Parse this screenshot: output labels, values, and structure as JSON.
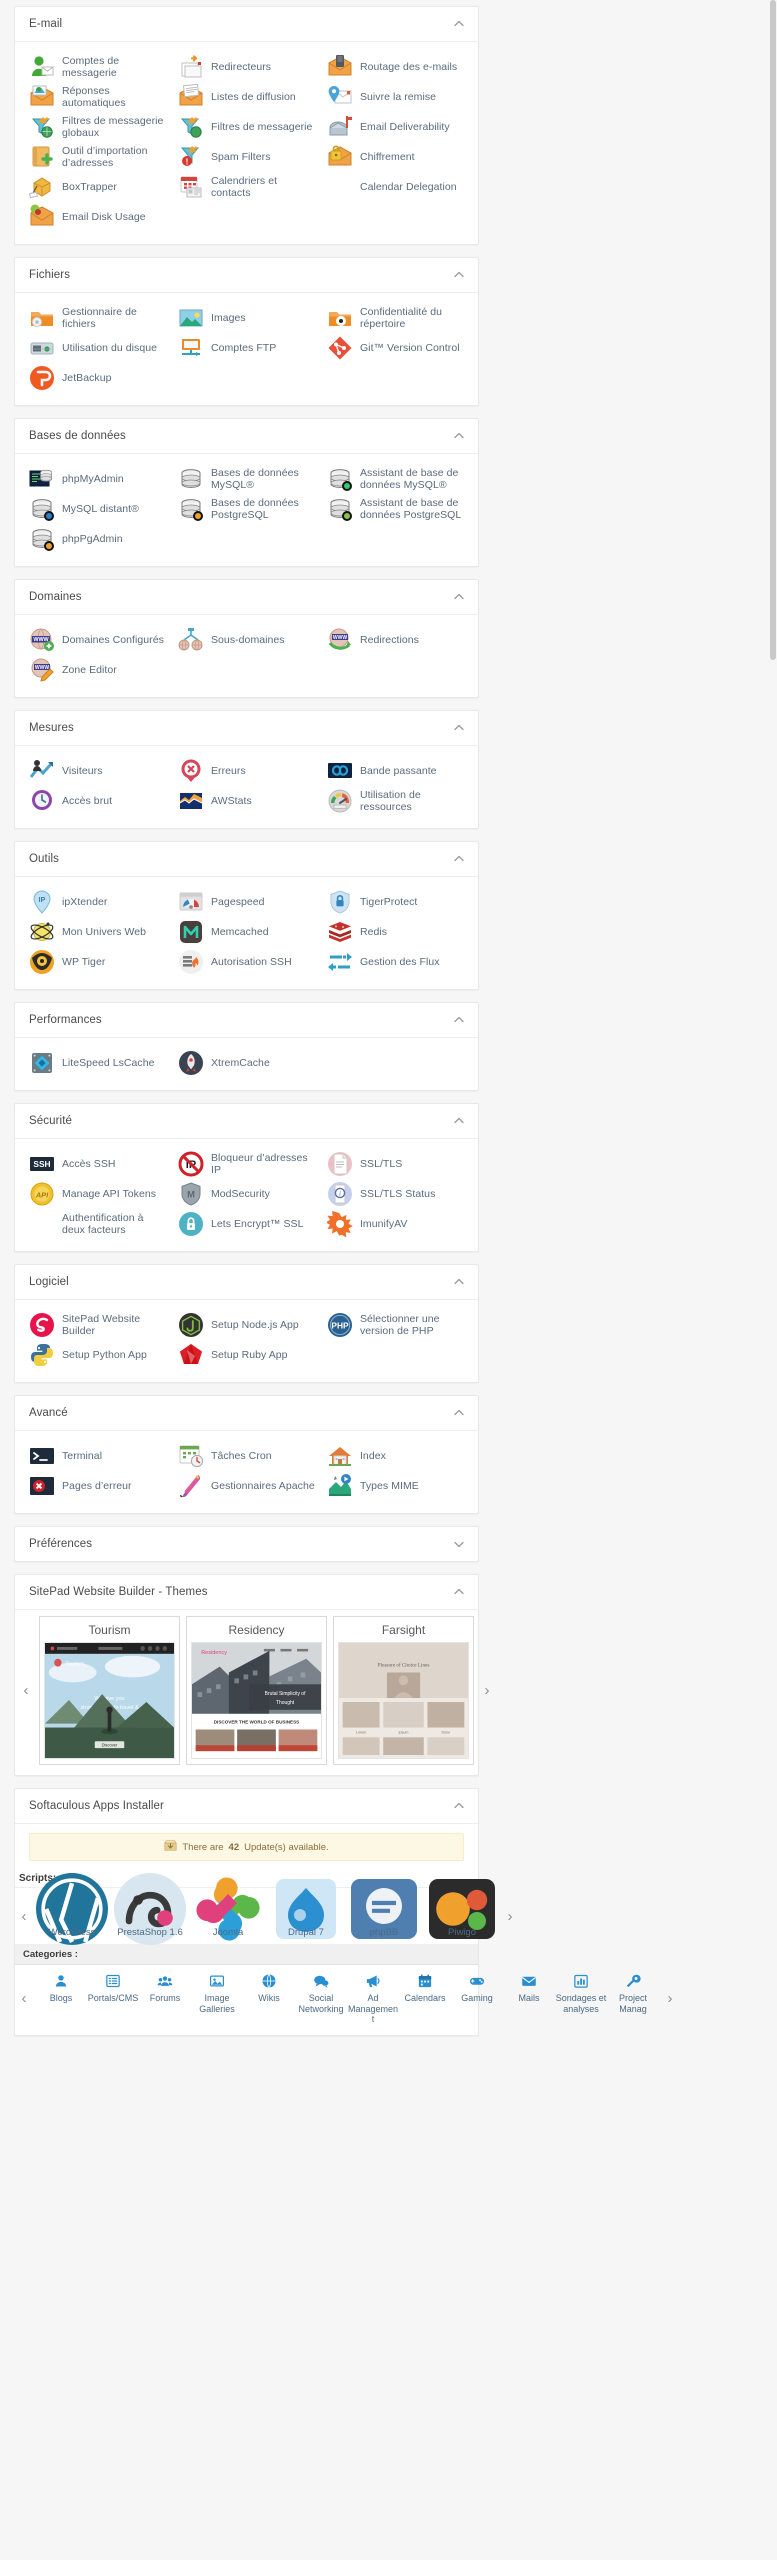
{
  "sections": [
    {
      "id": "email",
      "title": "E-mail",
      "collapse_icon": "chevron-up-icon",
      "items": [
        {
          "label": "Comptes de messagerie",
          "icon": "email-accounts-icon"
        },
        {
          "label": "Redirecteurs",
          "icon": "forwarders-icon"
        },
        {
          "label": "Routage des e-mails",
          "icon": "email-routing-icon"
        },
        {
          "label": "Réponses automatiques",
          "icon": "autoresponders-icon"
        },
        {
          "label": "Listes de diffusion",
          "icon": "mailing-lists-icon"
        },
        {
          "label": "Suivre la remise",
          "icon": "track-delivery-icon"
        },
        {
          "label": "Filtres de messagerie globaux",
          "icon": "global-email-filters-icon"
        },
        {
          "label": "Filtres de messagerie",
          "icon": "email-filters-icon"
        },
        {
          "label": "Email Deliverability",
          "icon": "email-deliverability-icon"
        },
        {
          "label": "Outil d’importation d’adresses",
          "icon": "address-importer-icon"
        },
        {
          "label": "Spam Filters",
          "icon": "spam-filters-icon"
        },
        {
          "label": "Chiffrement",
          "icon": "encryption-icon"
        },
        {
          "label": "BoxTrapper",
          "icon": "boxtrapper-icon"
        },
        {
          "label": "Calendriers et contacts",
          "icon": "calendars-contacts-icon"
        },
        {
          "label": "Calendar Delegation",
          "icon": "none"
        },
        {
          "label": "Email Disk Usage",
          "icon": "email-disk-usage-icon"
        }
      ]
    },
    {
      "id": "fichiers",
      "title": "Fichiers",
      "collapse_icon": "chevron-up-icon",
      "items": [
        {
          "label": "Gestionnaire de fichiers",
          "icon": "file-manager-icon"
        },
        {
          "label": "Images",
          "icon": "images-icon"
        },
        {
          "label": "Confidentialité du répertoire",
          "icon": "directory-privacy-icon"
        },
        {
          "label": "Utilisation du disque",
          "icon": "disk-usage-icon"
        },
        {
          "label": "Comptes FTP",
          "icon": "ftp-accounts-icon"
        },
        {
          "label": "Git™ Version Control",
          "icon": "git-version-control-icon"
        },
        {
          "label": "JetBackup",
          "icon": "jetbackup-icon"
        }
      ]
    },
    {
      "id": "bases",
      "title": "Bases de données",
      "collapse_icon": "chevron-up-icon",
      "items": [
        {
          "label": "phpMyAdmin",
          "icon": "phpmyadmin-icon"
        },
        {
          "label": "Bases de données MySQL®",
          "icon": "mysql-databases-icon"
        },
        {
          "label": "Assistant de base de données MySQL®",
          "icon": "mysql-wizard-icon"
        },
        {
          "label": "MySQL distant®",
          "icon": "remote-mysql-icon"
        },
        {
          "label": "Bases de données PostgreSQL",
          "icon": "postgresql-databases-icon"
        },
        {
          "label": "Assistant de base de données PostgreSQL",
          "icon": "postgresql-wizard-icon"
        },
        {
          "label": "phpPgAdmin",
          "icon": "phppgadmin-icon"
        }
      ]
    },
    {
      "id": "domaines",
      "title": "Domaines",
      "collapse_icon": "chevron-up-icon",
      "items": [
        {
          "label": "Domaines Configurés",
          "icon": "domains-icon"
        },
        {
          "label": "Sous-domaines",
          "icon": "subdomains-icon"
        },
        {
          "label": "Redirections",
          "icon": "redirects-icon"
        },
        {
          "label": "Zone Editor",
          "icon": "zone-editor-icon"
        }
      ]
    },
    {
      "id": "mesures",
      "title": "Mesures",
      "collapse_icon": "chevron-up-icon",
      "items": [
        {
          "label": "Visiteurs",
          "icon": "visitors-icon"
        },
        {
          "label": "Erreurs",
          "icon": "errors-icon"
        },
        {
          "label": "Bande passante",
          "icon": "bandwidth-icon"
        },
        {
          "label": "Accès brut",
          "icon": "raw-access-icon"
        },
        {
          "label": "AWStats",
          "icon": "awstats-icon"
        },
        {
          "label": "Utilisation de ressources",
          "icon": "resource-usage-icon"
        }
      ]
    },
    {
      "id": "outils",
      "title": "Outils",
      "collapse_icon": "chevron-up-icon",
      "items": [
        {
          "label": "ipXtender",
          "icon": "ipxtender-icon"
        },
        {
          "label": "Pagespeed",
          "icon": "pagespeed-icon"
        },
        {
          "label": "TigerProtect",
          "icon": "tigerprotect-icon"
        },
        {
          "label": "Mon Univers Web",
          "icon": "mon-univers-web-icon"
        },
        {
          "label": "Memcached",
          "icon": "memcached-icon"
        },
        {
          "label": "Redis",
          "icon": "redis-icon"
        },
        {
          "label": "WP Tiger",
          "icon": "wp-tiger-icon"
        },
        {
          "label": "Autorisation SSH",
          "icon": "ssh-authorization-icon"
        },
        {
          "label": "Gestion des Flux",
          "icon": "flux-management-icon"
        }
      ]
    },
    {
      "id": "performances",
      "title": "Performances",
      "collapse_icon": "chevron-up-icon",
      "items": [
        {
          "label": "LiteSpeed LsCache",
          "icon": "litespeed-lscache-icon"
        },
        {
          "label": "XtremCache",
          "icon": "xtremcache-icon"
        }
      ]
    },
    {
      "id": "securite",
      "title": "Sécurité",
      "collapse_icon": "chevron-up-icon",
      "items": [
        {
          "label": "Accès SSH",
          "icon": "ssh-access-icon"
        },
        {
          "label": "Bloqueur d’adresses IP",
          "icon": "ip-blocker-icon"
        },
        {
          "label": "SSL/TLS",
          "icon": "ssl-tls-icon"
        },
        {
          "label": "Manage API Tokens",
          "icon": "api-tokens-icon"
        },
        {
          "label": "ModSecurity",
          "icon": "modsecurity-icon"
        },
        {
          "label": "SSL/TLS Status",
          "icon": "ssl-tls-status-icon"
        },
        {
          "label": "Authentification à deux facteurs",
          "icon": "none"
        },
        {
          "label": "Lets Encrypt™ SSL",
          "icon": "lets-encrypt-icon"
        },
        {
          "label": "ImunifyAV",
          "icon": "imunifyav-icon"
        }
      ]
    },
    {
      "id": "logiciel",
      "title": "Logiciel",
      "collapse_icon": "chevron-up-icon",
      "items": [
        {
          "label": "SitePad Website Builder",
          "icon": "sitepad-icon"
        },
        {
          "label": "Setup Node.js App",
          "icon": "nodejs-icon"
        },
        {
          "label": "Sélectionner une version de PHP",
          "icon": "php-selector-icon"
        },
        {
          "label": "Setup Python App",
          "icon": "python-icon"
        },
        {
          "label": "Setup Ruby App",
          "icon": "ruby-icon"
        }
      ]
    },
    {
      "id": "avance",
      "title": "Avancé",
      "collapse_icon": "chevron-up-icon",
      "items": [
        {
          "label": "Terminal",
          "icon": "terminal-icon"
        },
        {
          "label": "Tâches Cron",
          "icon": "cron-jobs-icon"
        },
        {
          "label": "Index",
          "icon": "indexes-icon"
        },
        {
          "label": "Pages d’erreur",
          "icon": "error-pages-icon"
        },
        {
          "label": "Gestionnaires Apache",
          "icon": "apache-handlers-icon"
        },
        {
          "label": "Types MIME",
          "icon": "mime-types-icon"
        }
      ]
    },
    {
      "id": "preferences",
      "title": "Préférences",
      "collapse_icon": "chevron-down-icon",
      "items": []
    }
  ],
  "themes_panel": {
    "title": "SitePad Website Builder - Themes",
    "collapse_icon": "chevron-up-icon",
    "prev_arrow": "‹",
    "next_arrow": "›",
    "themes": [
      {
        "name": "Tourism",
        "hero_text": "We give you strong desire to travel &",
        "brand": "Tourism",
        "cta": "Discover"
      },
      {
        "name": "Residency",
        "hero_text": "Brutal Simplicity of Thought",
        "brand": "Residency",
        "cta": "DISCOVER THE WORLD OF BUSINESS"
      },
      {
        "name": "Farsight",
        "hero_text": "Pleasure of Choice Lines",
        "brand": "Farsight",
        "cta": ""
      }
    ]
  },
  "softaculous": {
    "title": "Softaculous Apps Installer",
    "collapse_icon": "chevron-up-icon",
    "alert_prefix": "There are",
    "alert_count": "42",
    "alert_suffix": "Update(s) available.",
    "alert_icon": "update-box-icon",
    "scripts_label": "Scripts:",
    "categories_label": "Categories :",
    "prev_arrow": "‹",
    "next_arrow": "›",
    "apps": [
      {
        "name": "WordPress",
        "icon": "wordpress-icon"
      },
      {
        "name": "PrestaShop 1.6",
        "icon": "prestashop-icon"
      },
      {
        "name": "Joomla",
        "icon": "joomla-icon"
      },
      {
        "name": "Drupal 7",
        "icon": "drupal-icon"
      },
      {
        "name": "phpBB",
        "icon": "phpbb-icon"
      },
      {
        "name": "Piwigo",
        "icon": "piwigo-icon"
      }
    ],
    "categories": [
      {
        "name": "Blogs",
        "icon": "person-icon"
      },
      {
        "name": "Portals/CMS",
        "icon": "list-icon"
      },
      {
        "name": "Forums",
        "icon": "people-icon"
      },
      {
        "name": "Image Galleries",
        "icon": "picture-icon"
      },
      {
        "name": "Wikis",
        "icon": "globe-icon"
      },
      {
        "name": "Social Networking",
        "icon": "chat-icon"
      },
      {
        "name": "Ad Management",
        "icon": "megaphone-icon"
      },
      {
        "name": "Calendars",
        "icon": "calendar-icon"
      },
      {
        "name": "Gaming",
        "icon": "gamepad-icon"
      },
      {
        "name": "Mails",
        "icon": "envelope-icon"
      },
      {
        "name": "Sondages et analyses",
        "icon": "chart-icon"
      },
      {
        "name": "Project Manag",
        "icon": "wrench-icon"
      }
    ]
  },
  "colors": {
    "link": "#5a6b7d",
    "panel_bg": "#ffffff",
    "page_bg": "#f6f6f6",
    "alert_bg": "#fcf8e3",
    "alert_text": "#8a6d3b",
    "soft_link": "#4b6a86"
  }
}
